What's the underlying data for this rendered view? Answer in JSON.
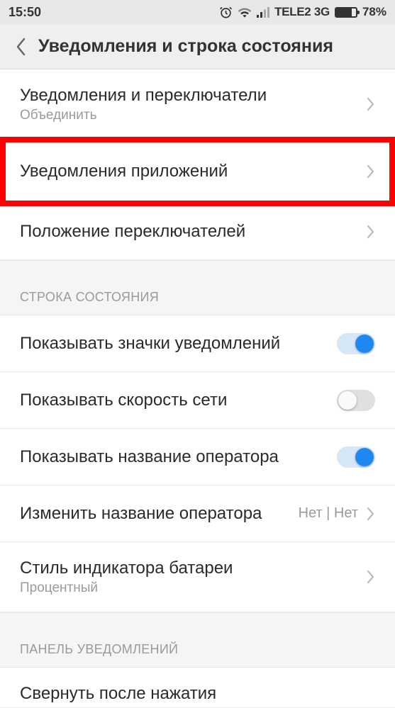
{
  "status_bar": {
    "time": "15:50",
    "carrier": "TELE2 3G",
    "battery_pct": "78%"
  },
  "header": {
    "title": "Уведомления и строка состояния"
  },
  "group1": {
    "items": [
      {
        "title": "Уведомления и переключатели",
        "subtitle": "Объединить"
      },
      {
        "title": "Уведомления приложений"
      },
      {
        "title": "Положение переключателей"
      }
    ]
  },
  "group2": {
    "header": "СТРОКА СОСТОЯНИЯ",
    "items": [
      {
        "title": "Показывать значки уведомлений",
        "toggle": true
      },
      {
        "title": "Показывать скорость сети",
        "toggle": false
      },
      {
        "title": "Показывать название оператора",
        "toggle": true
      },
      {
        "title": "Изменить название оператора",
        "value": "Нет | Нет"
      },
      {
        "title": "Стиль индикатора батареи",
        "subtitle": "Процентный"
      }
    ]
  },
  "group3": {
    "header": "ПАНЕЛЬ УВЕДОМЛЕНИЙ",
    "items": [
      {
        "title": "Свернуть после нажатия"
      }
    ]
  }
}
